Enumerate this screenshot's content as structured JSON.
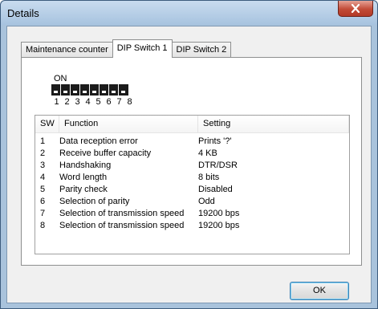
{
  "window": {
    "title": "Details"
  },
  "tabs": [
    {
      "label": "Maintenance counter",
      "active": false
    },
    {
      "label": "DIP Switch 1",
      "active": true
    },
    {
      "label": "DIP Switch 2",
      "active": false
    }
  ],
  "dip": {
    "on_label": "ON",
    "numbers": [
      "1",
      "2",
      "3",
      "4",
      "5",
      "6",
      "7",
      "8"
    ]
  },
  "table": {
    "columns": [
      "SW",
      "Function",
      "Setting"
    ],
    "rows": [
      {
        "sw": "1",
        "function": "Data reception error",
        "setting": "Prints '?'"
      },
      {
        "sw": "2",
        "function": "Receive buffer capacity",
        "setting": "4 KB"
      },
      {
        "sw": "3",
        "function": "Handshaking",
        "setting": "DTR/DSR"
      },
      {
        "sw": "4",
        "function": "Word length",
        "setting": "8 bits"
      },
      {
        "sw": "5",
        "function": "Parity check",
        "setting": "Disabled"
      },
      {
        "sw": "6",
        "function": "Selection of parity",
        "setting": "Odd"
      },
      {
        "sw": "7",
        "function": "Selection of transmission speed",
        "setting": "19200 bps"
      },
      {
        "sw": "8",
        "function": "Selection of transmission speed",
        "setting": "19200 bps"
      }
    ]
  },
  "buttons": {
    "ok": "OK"
  },
  "icons": {
    "close": "close-icon"
  },
  "colors": {
    "close_button": "#c24b37",
    "title_bar": "#a9c3dc"
  }
}
